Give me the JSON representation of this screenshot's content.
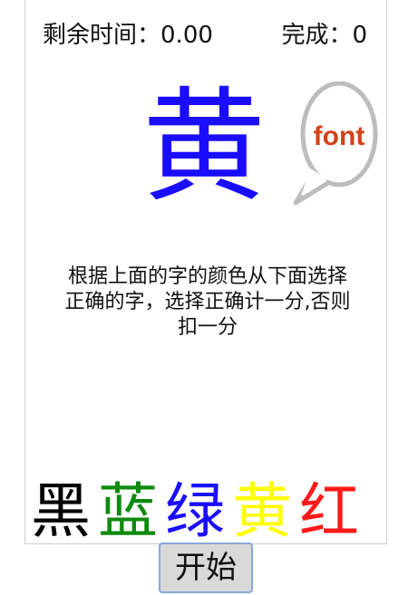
{
  "status": {
    "timer_label": "剩余时间：",
    "timer_value": "0.00",
    "score_label": "完成：",
    "score_value": "0"
  },
  "target": {
    "char": "黄",
    "color": "#1a0dff"
  },
  "bubble": {
    "label": "font",
    "icon": "speech-bubble-icon"
  },
  "instructions": "根据上面的字的颜色从下面选择正确的字，选择正确计一分,否则扣一分",
  "options": [
    {
      "char": "黑",
      "color": "#000000"
    },
    {
      "char": "蓝",
      "color": "#0f8a0f"
    },
    {
      "char": "绿",
      "color": "#1a0dff"
    },
    {
      "char": "黄",
      "color": "#ffff00"
    },
    {
      "char": "红",
      "color": "#ff1a1a"
    }
  ],
  "start_button": {
    "label": "开始"
  }
}
